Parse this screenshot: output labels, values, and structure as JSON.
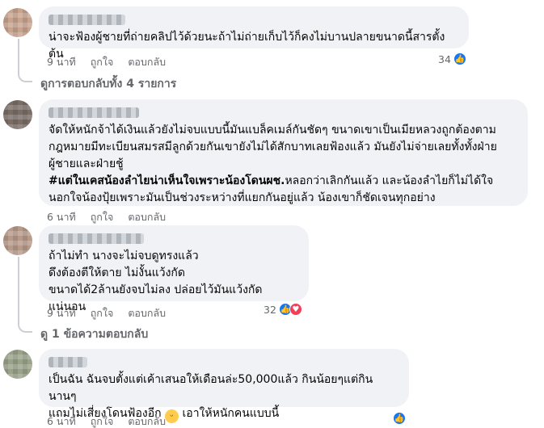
{
  "comments": [
    {
      "text": "น่าจะฟ้องผู้ชายที่ถ่ายคลิปไว้ด้วยนะถ้าไม่ถ่ายเก็บไว้ก็คงไม่บานปลายขนาดนี้สารตั้งต้น",
      "time": "9 นาที",
      "like_label": "ถูกใจ",
      "reply_label": "ตอบกลับ",
      "reaction_count": "34"
    },
    {
      "text_part1": "จัดให้หนักจ้าได้เงินแล้วยังไม่จบแบบนี้มันแบล็คเมล์กันชัดๆ ขนาดเขาเป็นเมียหลวงถูกต้องตามกฎหมายมีทะเบียนสมรสมีลูกด้วยกันเขายังไม่ได้สักบาทเลยฟ้องแล้ว มันยังไม่จ่ายเลยทั้งทั้งฝ่ายผู้ชายและฝ่ายชู้\n",
      "hashtag": "#แต่ในเคสน้องลำไยน่าเห็นใจเพราะน้องโดนผช.",
      "text_part2": "หลอกว่าเลิกกันแล้ว และน้องลำไยก็ไม่ได้ใจนอกใจน้องปุ้ยเพราะมันเป็นช่วงระหว่างที่แยกกันอยู่แล้ว น้องเขาก็ชัดเจนทุกอย่าง",
      "time": "6 นาที",
      "like_label": "ถูกใจ",
      "reply_label": "ตอบกลับ"
    },
    {
      "text": "ถ้าไม่ทำ นางจะไม่จบดูทรงแล้ว\nดึงต้องตีให้ตาย ไม่งั้นแว้งกัด\nขนาดได้2ล้านยังจบไม่ลง ปล่อยไว้มันแว้งกัดแน่นอน",
      "time": "9 นาที",
      "like_label": "ถูกใจ",
      "reply_label": "ตอบกลับ",
      "reaction_count": "32"
    },
    {
      "text_part1": "เป็นฉัน ฉันจบตั้งแต่เค้าเสนอให้เดือนล่ะ50,000แล้ว กินน้อยๆแต่กินนานๆ\nแถมไม่เสี่ยงโดนฟ้องอีก ",
      "text_part2": " เอาให้หนักคนแบบนี้",
      "time": "6 นาที",
      "like_label": "ถูกใจ",
      "reply_label": "ตอบกลับ"
    }
  ],
  "view_replies_1": "ดูการตอบกลับทั้ง 4 รายการ",
  "view_replies_2": "ดู 1 ข้อความตอบกลับ",
  "colors": {
    "bubble": "#f0f2f5",
    "meta": "#65676b",
    "like": "#1877f2",
    "love": "#f33e58"
  },
  "icons": {
    "like": "thumbs-up-icon",
    "love": "heart-icon",
    "emoji": "grinning-sweat-emoji"
  }
}
